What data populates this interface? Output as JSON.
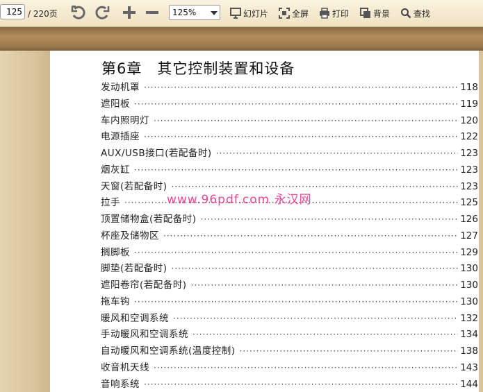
{
  "toolbar": {
    "page_current": "125",
    "page_total": "/ 220页",
    "zoom": "125%",
    "slideshow_label": "幻灯片",
    "fullscreen_label": "全屏",
    "print_label": "打印",
    "background_label": "背景",
    "search_label": "查找",
    "icons": [
      "undo-icon",
      "redo-icon",
      "zoom-in-icon",
      "zoom-out-icon",
      "slideshow-icon",
      "fullscreen-icon",
      "print-icon",
      "background-icon",
      "search-icon"
    ]
  },
  "document": {
    "chapter_title": "第6章　其它控制装置和设备",
    "watermark": "www.96pdf.com 永汉网",
    "toc": [
      {
        "title": "发动机罩",
        "page": "118"
      },
      {
        "title": "遮阳板",
        "page": "119"
      },
      {
        "title": "车内照明灯",
        "page": "120"
      },
      {
        "title": "电源插座",
        "page": "122"
      },
      {
        "title": "AUX/USB接口(若配备时)",
        "page": "123"
      },
      {
        "title": "烟灰缸",
        "page": "123"
      },
      {
        "title": "天窗(若配备时)",
        "page": "123"
      },
      {
        "title": "拉手",
        "page": "125"
      },
      {
        "title": "顶置储物盒(若配备时)",
        "page": "126"
      },
      {
        "title": "杯座及储物区",
        "page": "127"
      },
      {
        "title": "搁脚板",
        "page": "129"
      },
      {
        "title": "脚垫(若配备时)",
        "page": "130"
      },
      {
        "title": "遮阳卷帘(若配备时)",
        "page": "130"
      },
      {
        "title": "拖车钩",
        "page": "130"
      },
      {
        "title": "暖风和空调系统",
        "page": "132"
      },
      {
        "title": "手动暖风和空调系统",
        "page": "134"
      },
      {
        "title": "自动暖风和空调系统(温度控制)",
        "page": "138"
      },
      {
        "title": "收音机天线",
        "page": "143"
      },
      {
        "title": "音响系统",
        "page": "144"
      }
    ]
  }
}
